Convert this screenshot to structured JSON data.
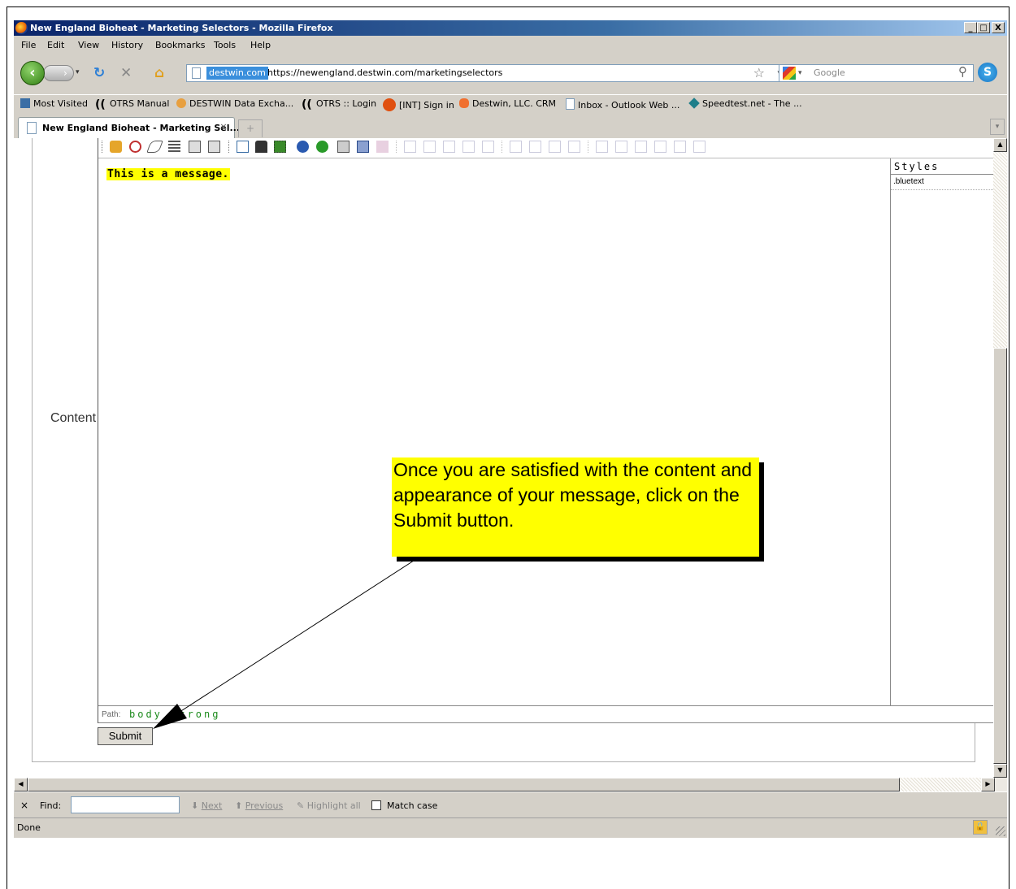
{
  "window": {
    "title": "New England Bioheat - Marketing Selectors - Mozilla Firefox",
    "controls": [
      "_",
      "□",
      "X"
    ]
  },
  "menu": [
    "File",
    "Edit",
    "View",
    "History",
    "Bookmarks",
    "Tools",
    "Help"
  ],
  "nav": {
    "site_badge": "destwin.com",
    "url": "https://newengland.destwin.com/marketingselectors",
    "search_placeholder": "Google"
  },
  "bookmarks": [
    {
      "label": "Most Visited",
      "icon": "most-visited-icon"
    },
    {
      "label": "OTRS Manual",
      "icon": "otrs-icon"
    },
    {
      "label": "DESTWIN Data Excha...",
      "icon": "destwin-icon"
    },
    {
      "label": "OTRS :: Login",
      "icon": "otrs-icon"
    },
    {
      "label": "[INT] Sign in",
      "icon": "int-icon"
    },
    {
      "label": "Destwin, LLC. CRM",
      "icon": "crm-icon"
    },
    {
      "label": "Inbox - Outlook Web ...",
      "icon": "page-icon"
    },
    {
      "label": "Speedtest.net - The ...",
      "icon": "speedtest-icon"
    }
  ],
  "tab": {
    "label": "New England Bioheat - Marketing Sel...",
    "new_tab": "+"
  },
  "page": {
    "content_label": "Content",
    "editor_message": "This is a message.",
    "styles_title": "Styles",
    "styles_item": ".bluetext",
    "path_label": "Path:",
    "path_items": "body strong",
    "submit_label": "Submit"
  },
  "callout": {
    "text": "Once you are satisfied with the content and appearance of your message, click on the Submit button."
  },
  "findbar": {
    "close": "×",
    "label": "Find:",
    "next": "Next",
    "previous": "Previous",
    "highlight": "Highlight all",
    "match_case": "Match case"
  },
  "status": {
    "text": "Done"
  },
  "colors": {
    "titlebar": "#0a246a",
    "chrome": "#d4d0c8",
    "callout_bg": "#ffff00",
    "path_text": "#1b8a1b"
  }
}
